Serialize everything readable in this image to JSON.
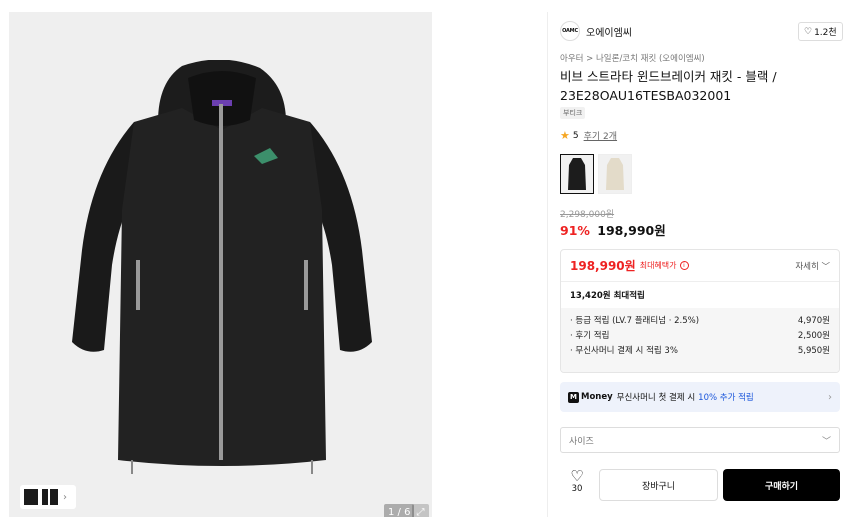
{
  "gallery": {
    "pager": "1 / 6",
    "expand_icon": "expand-icon",
    "thumb_chevron": "›"
  },
  "brand": {
    "logo_text": "OAMC",
    "name": "오에이엠씨",
    "likes": "1.2천"
  },
  "breadcrumb": "아우터 > 나일론/코치 재킷 (오에이엠씨)",
  "product": {
    "title": "비브 스트라타 윈드브레이커 재킷 - 블랙 / 23E28OAU16TESBA032001",
    "tag": "부티크",
    "rating": "5",
    "reviews": "후기 2개",
    "original_price": "2,298,000원",
    "discount": "91%",
    "price": "198,990원"
  },
  "benefit": {
    "max_price": "198,990원",
    "max_label": "최대혜택가",
    "info_icon": "i",
    "detail_label": "자세히 ﹀",
    "accumulate": "13,420원 최대적립",
    "items": [
      {
        "label": "· 등급 적립 (LV.7 플래티넘 · 2.5%)",
        "value": "4,970원"
      },
      {
        "label": "· 후기 적립",
        "value": "2,500원"
      },
      {
        "label": "· 무신사머니 결제 시 적립 3%",
        "value": "5,950원"
      }
    ]
  },
  "money": {
    "logo": "M",
    "word": "Money",
    "text1": "무신사머니 첫 결제 시",
    "highlight": "10% 추가 적립",
    "chevron": "›"
  },
  "size_select": {
    "placeholder": "사이즈",
    "chevron": "﹀"
  },
  "actions": {
    "wish_count": "30",
    "cart": "장바구니",
    "buy": "구매하기"
  },
  "colors": {
    "accent_red": "#ee2222",
    "money_blue": "#1a56db",
    "buy_black": "#000000"
  }
}
